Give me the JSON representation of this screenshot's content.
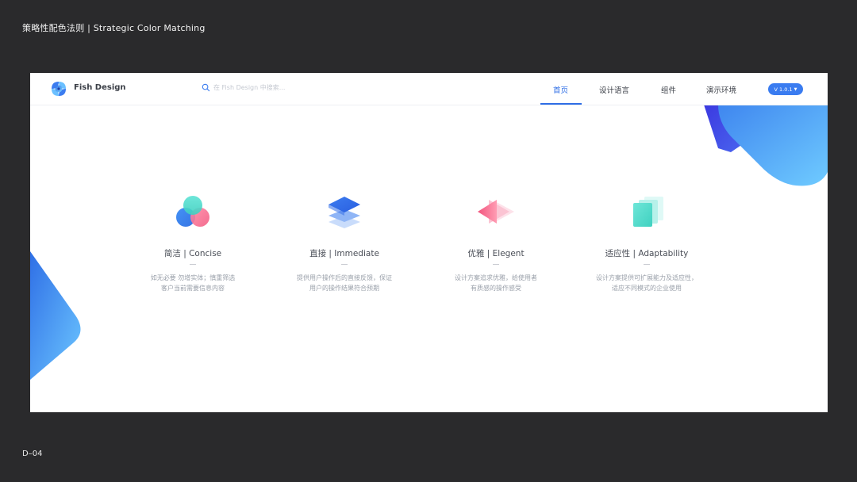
{
  "slide": {
    "title": "策略性配色法则 | Strategic Color Matching",
    "footer": "D–04"
  },
  "header": {
    "brand": "Fish Design",
    "search_placeholder": "在 Fish Design 中搜索...",
    "nav": [
      {
        "label": "首页",
        "active": true
      },
      {
        "label": "设计语言",
        "active": false
      },
      {
        "label": "组件",
        "active": false
      },
      {
        "label": "演示环境",
        "active": false
      }
    ],
    "version": "V 1.0.1",
    "accent_color": "#2f6ee6"
  },
  "features": [
    {
      "icon": "concise-circles-icon",
      "title": "简洁 | Concise",
      "desc_line1": "如无必要 勿增实体；慎重筛选",
      "desc_line2": "客户当前需要信息内容"
    },
    {
      "icon": "immediate-layers-icon",
      "title": "直接 | Immediate",
      "desc_line1": "提供用户操作后的直接反馈，保证",
      "desc_line2": "用户的操作结果符合预期"
    },
    {
      "icon": "elegant-arrow-icon",
      "title": "优雅 | Elegent",
      "desc_line1": "设计方案追求优雅，给使用者",
      "desc_line2": "有质感的操作感受"
    },
    {
      "icon": "adaptability-cards-icon",
      "title": "适应性 | Adaptability",
      "desc_line1": "设计方案提供可扩展能力及适应性，",
      "desc_line2": "适应不同模式的企业使用"
    }
  ]
}
